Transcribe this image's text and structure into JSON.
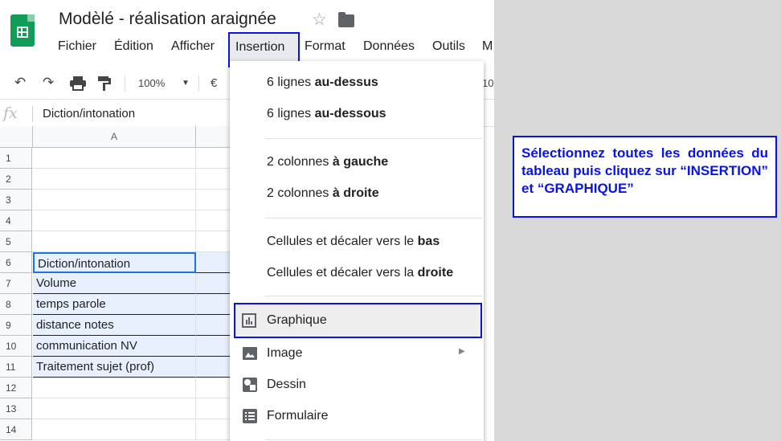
{
  "doc": {
    "title": "Modèlé - réalisation araignée"
  },
  "menubar": [
    "Fichier",
    "Édition",
    "Afficher",
    "Insertion",
    "Format",
    "Données",
    "Outils",
    "M"
  ],
  "toolbar": {
    "zoom": "100%",
    "currency": "€",
    "trailing": "10"
  },
  "formula_bar": {
    "fx": "fx",
    "value": "Diction/intonation"
  },
  "columns": [
    "A"
  ],
  "rows": [
    {
      "num": "1",
      "a": ""
    },
    {
      "num": "2",
      "a": ""
    },
    {
      "num": "3",
      "a": ""
    },
    {
      "num": "4",
      "a": ""
    },
    {
      "num": "5",
      "a": ""
    },
    {
      "num": "6",
      "a": "Diction/intonation"
    },
    {
      "num": "7",
      "a": "Volume"
    },
    {
      "num": "8",
      "a": "temps parole"
    },
    {
      "num": "9",
      "a": "distance notes"
    },
    {
      "num": "10",
      "a": "communication NV"
    },
    {
      "num": "11",
      "a": "Traitement sujet (prof)"
    },
    {
      "num": "12",
      "a": ""
    },
    {
      "num": "13",
      "a": ""
    },
    {
      "num": "14",
      "a": ""
    }
  ],
  "dropdown": {
    "rows_above": {
      "prefix": "6 lignes ",
      "bold": "au-dessus"
    },
    "rows_below": {
      "prefix": "6 lignes ",
      "bold": "au-dessous"
    },
    "cols_left": {
      "prefix": "2 colonnes ",
      "bold": "à gauche"
    },
    "cols_right": {
      "prefix": "2 colonnes ",
      "bold": "à droite"
    },
    "cells_down": {
      "prefix": "Cellules et décaler vers le ",
      "bold": "bas"
    },
    "cells_right": {
      "prefix": "Cellules et décaler vers la ",
      "bold": "droite"
    },
    "chart": "Graphique",
    "image": "Image",
    "drawing": "Dessin",
    "form": "Formulaire"
  },
  "callout": "Sélectionnez toutes les données du tableau puis cliquez sur “INSERTION” et “GRAPHIQUE”",
  "colors": {
    "highlight": "#0a12e6",
    "sheets_green": "#0f9d58",
    "selection": "#e8f0fe"
  }
}
